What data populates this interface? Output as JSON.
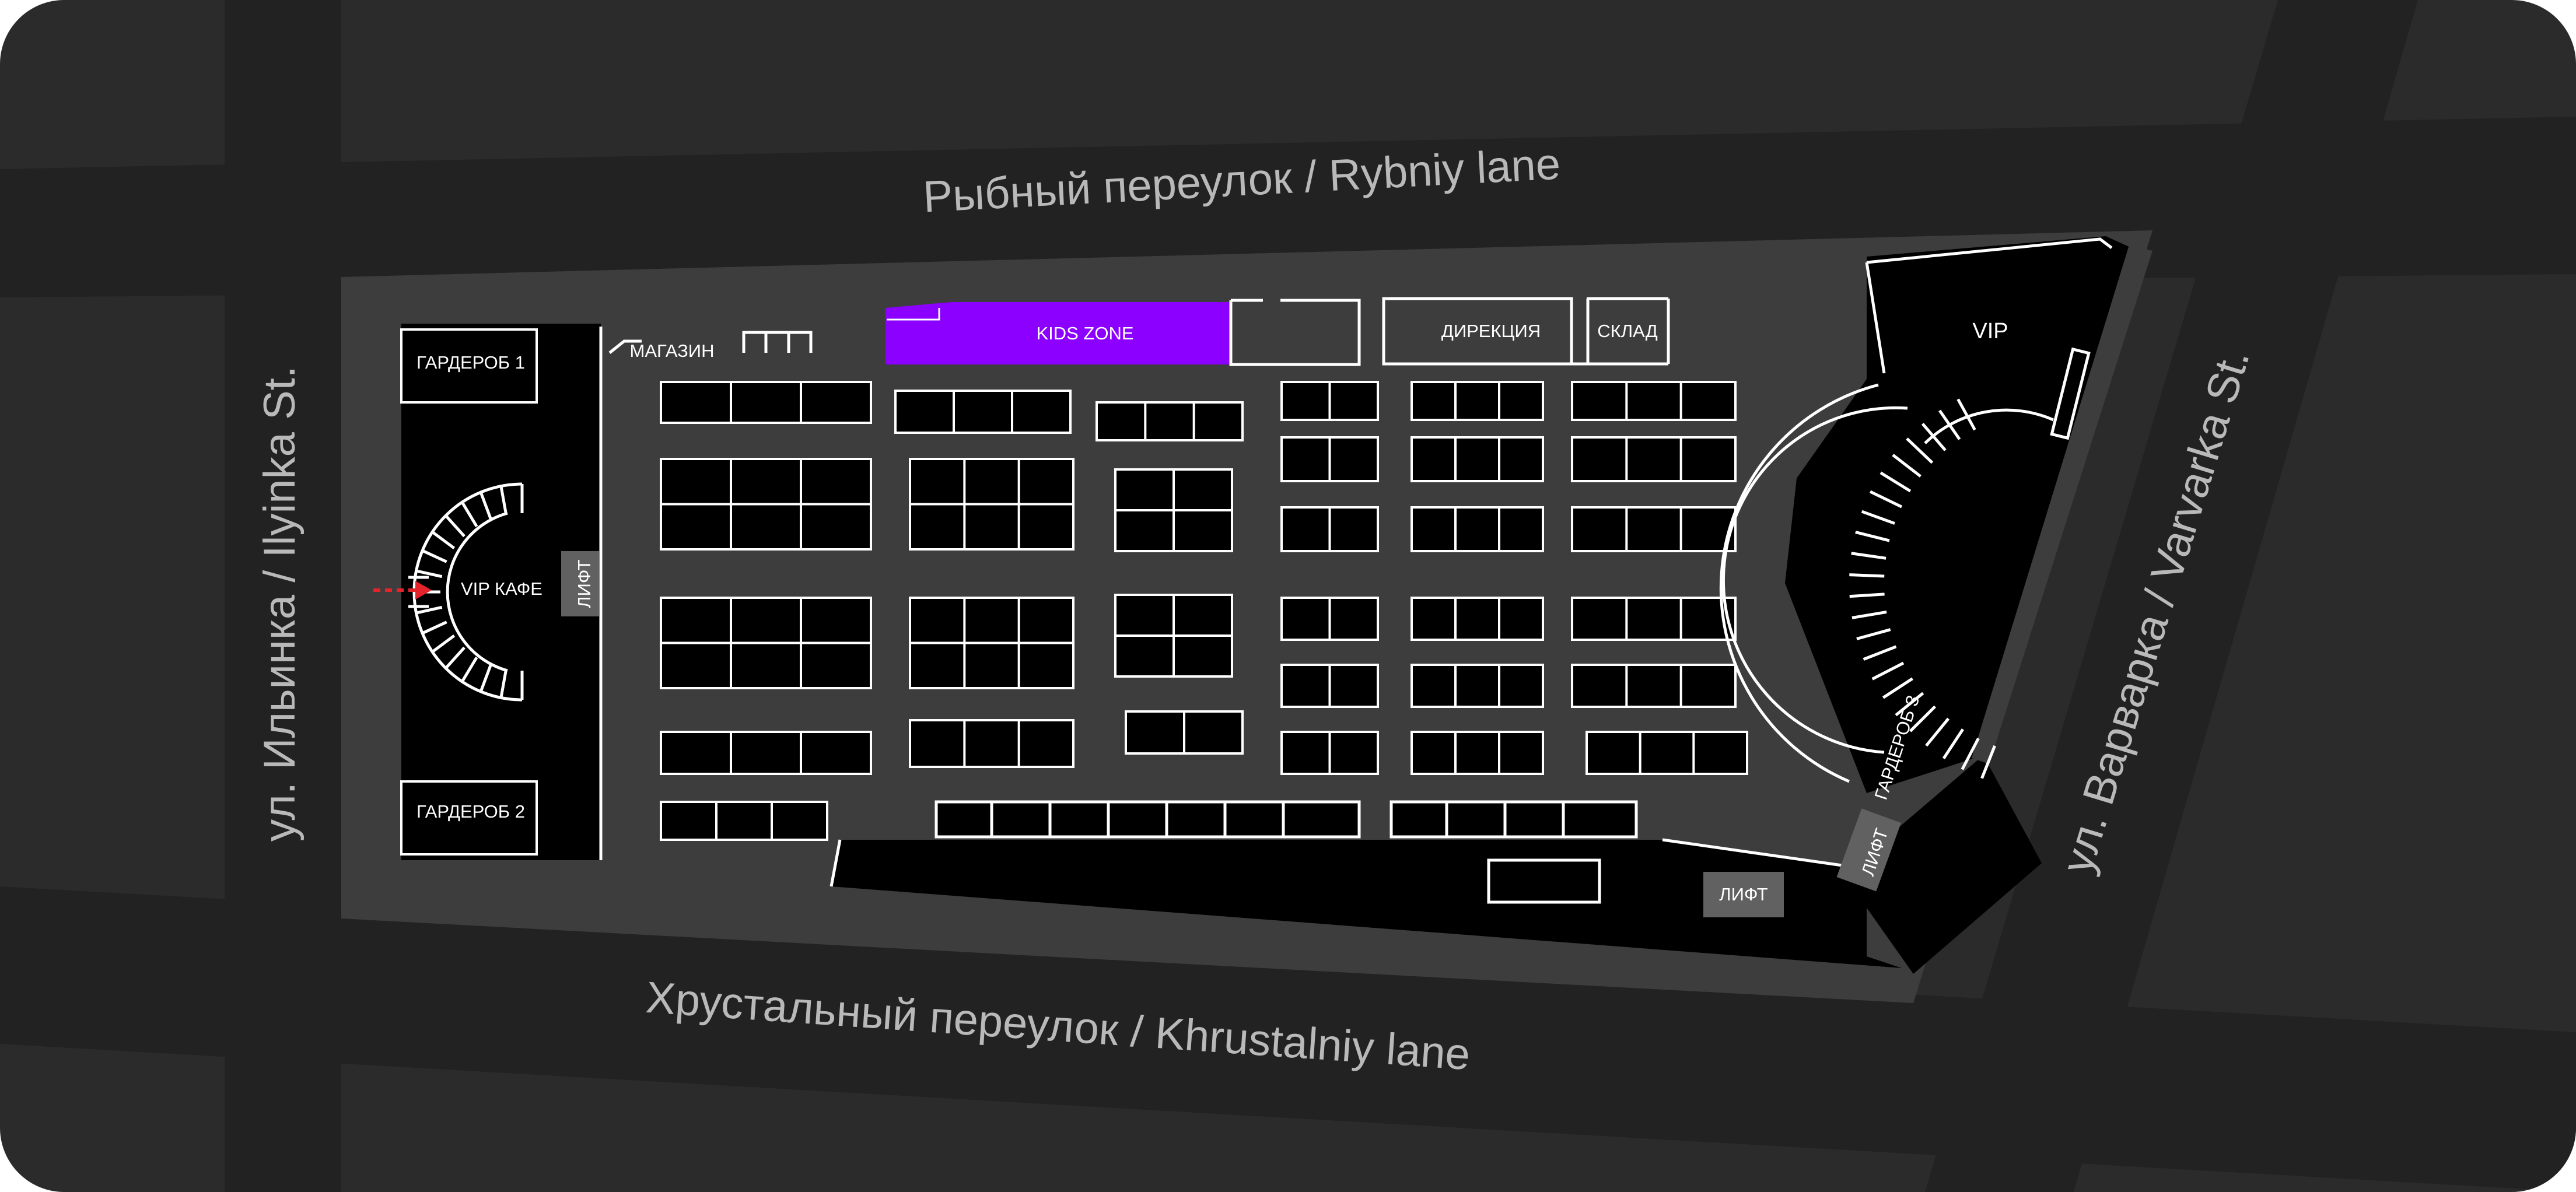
{
  "map": {
    "background_color": "#2b2b2b",
    "road_color": "#222222",
    "building_color": "#3d3d3d",
    "wall_color": "#000000",
    "accent_color": "#8b00ff",
    "arrow_color": "#e5232b"
  },
  "streets": {
    "north": "Рыбный переулок / Rybniy lane",
    "south": "Хрустальный переулок / Khrustalniy lane",
    "west": "ул. Ильинка / Ilyinka St.",
    "east": "ул. Варварка / Varvarka St."
  },
  "zones": {
    "wardrobe_1": "ГАРДЕРОБ 1",
    "wardrobe_2": "ГАРДЕРОБ 2",
    "wardrobe_3": "ГАРДЕРОБ 3",
    "vip_cafe": "VIP КАФЕ",
    "elevator": "ЛИФТ",
    "shop": "МАГАЗИН",
    "kids_zone": "KIDS ZONE",
    "management": "ДИРЕКЦИЯ",
    "storage": "СКЛАД",
    "vip": "VIP"
  }
}
